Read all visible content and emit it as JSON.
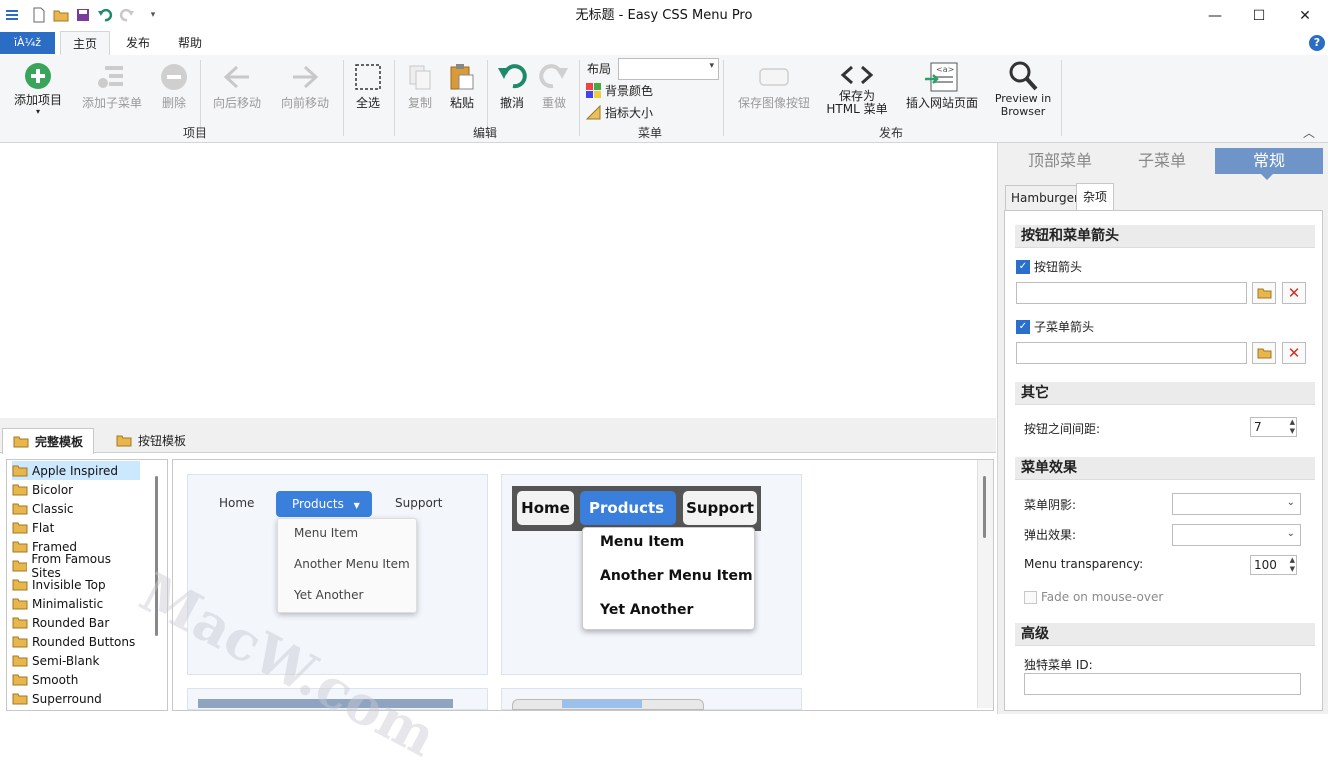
{
  "window": {
    "title": "无标题 - Easy CSS Menu Pro",
    "min": "—",
    "max": "☐",
    "close": "✕"
  },
  "ribbon_tabs": {
    "file": "ĭÀ¼ž",
    "home": "主页",
    "publish": "发布",
    "help": "帮助"
  },
  "ribbon": {
    "add_item": "添加项目",
    "add_submenu": "添加子菜单",
    "delete": "删除",
    "move_back": "向后移动",
    "move_forward": "向前移动",
    "select_all": "全选",
    "copy": "复制",
    "paste": "粘贴",
    "undo": "撤消",
    "redo": "重做",
    "layout_label": "布局",
    "bg_color": "背景颜色",
    "cursor_size": "指标大小",
    "save_image_btn": "保存图像按钮",
    "save_html_1": "保存为",
    "save_html_2": "HTML 菜单",
    "insert_page": "插入网站页面",
    "preview_1": "Preview in",
    "preview_2": "Browser",
    "groups": {
      "items": "项目",
      "edit": "编辑",
      "menu": "菜单",
      "publish": "发布"
    }
  },
  "templates": {
    "tabs": [
      "完整模板",
      "按钮模板"
    ],
    "list": [
      "Apple Inspired",
      "Bicolor",
      "Classic",
      "Flat",
      "Framed",
      "From Famous Sites",
      "Invisible Top",
      "Minimalistic",
      "Rounded Bar",
      "Rounded Buttons",
      "Semi-Blank",
      "Smooth",
      "Superround"
    ],
    "preview1": {
      "items": [
        "Home",
        "Products",
        "Support"
      ],
      "sub": [
        "Menu Item",
        "Another Menu Item",
        "Yet Another"
      ]
    },
    "preview2": {
      "items": [
        "Home",
        "Products",
        "Support"
      ],
      "sub": [
        "Menu Item",
        "Another Menu Item",
        "Yet Another"
      ]
    },
    "watermark": "MacW.com"
  },
  "panel": {
    "tabs": [
      "顶部菜单",
      "子菜单",
      "常规"
    ],
    "subtabs": [
      "Hamburger",
      "杂项"
    ],
    "sec_arrows": "按钮和菜单箭头",
    "btn_arrow": "按钮箭头",
    "submenu_arrow": "子菜单箭头",
    "sec_other": "其它",
    "spacing_label": "按钮之间间距:",
    "spacing_value": "7",
    "sec_effects": "菜单效果",
    "shadow_label": "菜单阴影:",
    "popup_label": "弹出效果:",
    "transparency_label": "Menu transparency:",
    "transparency_value": "100",
    "fade_label": "Fade on mouse-over",
    "sec_advanced": "高级",
    "menu_id_label": "独特菜单 ID:"
  },
  "colors": {
    "accent": "#2b6cc4",
    "panel_tab_active": "#6f95c8",
    "green": "#3aa55a"
  }
}
